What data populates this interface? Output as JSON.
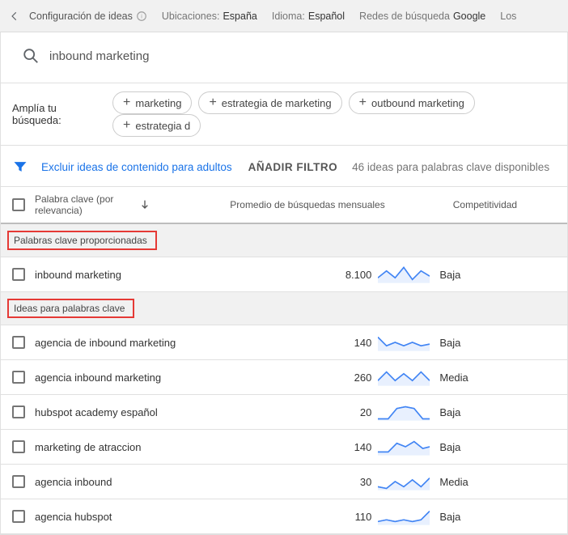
{
  "top": {
    "config_label": "Configuración de ideas",
    "locations_label": "Ubicaciones:",
    "locations_value": "España",
    "language_label": "Idioma:",
    "language_value": "Español",
    "networks_label": "Redes de búsqueda",
    "networks_value": "Google",
    "more": "Los"
  },
  "search": {
    "value": "inbound marketing"
  },
  "broaden": {
    "label": "Amplía tu búsqueda:",
    "chips": [
      "marketing",
      "estrategia de marketing",
      "outbound marketing",
      "estrategia d"
    ]
  },
  "filter": {
    "exclude": "Excluir ideas de contenido para adultos",
    "add": "AÑADIR FILTRO",
    "count": "46 ideas para palabras clave disponibles"
  },
  "columns": {
    "keyword": "Palabra clave (por relevancia)",
    "avg": "Promedio de búsquedas mensuales",
    "comp": "Competitividad"
  },
  "sections": {
    "provided": "Palabras clave proporcionadas",
    "ideas": "Ideas para palabras clave"
  },
  "rows_provided": [
    {
      "kw": "inbound marketing",
      "avg": "8.100",
      "comp": "Baja",
      "spark": "0,14 10,6 20,14 30,2 40,16 50,6 60,12"
    }
  ],
  "rows_ideas": [
    {
      "kw": "agencia de inbound marketing",
      "avg": "140",
      "comp": "Baja",
      "spark": "0,4 10,14 20,10 30,14 40,10 50,14 60,12"
    },
    {
      "kw": "agencia inbound marketing",
      "avg": "260",
      "comp": "Media",
      "spark": "0,14 10,4 20,14 30,6 40,14 50,4 60,14"
    },
    {
      "kw": "hubspot academy español",
      "avg": "20",
      "comp": "Baja",
      "spark": "0,18 12,18 22,6 32,4 42,6 52,18 60,18"
    },
    {
      "kw": "marketing de atraccion",
      "avg": "140",
      "comp": "Baja",
      "spark": "0,16 12,16 22,6 32,10 42,4 52,12 60,10"
    },
    {
      "kw": "agencia inbound",
      "avg": "30",
      "comp": "Media",
      "spark": "0,16 10,18 20,10 30,16 40,8 50,16 60,6"
    },
    {
      "kw": "agencia hubspot",
      "avg": "110",
      "comp": "Baja",
      "spark": "0,16 10,14 20,16 30,14 40,16 50,14 60,4"
    }
  ]
}
